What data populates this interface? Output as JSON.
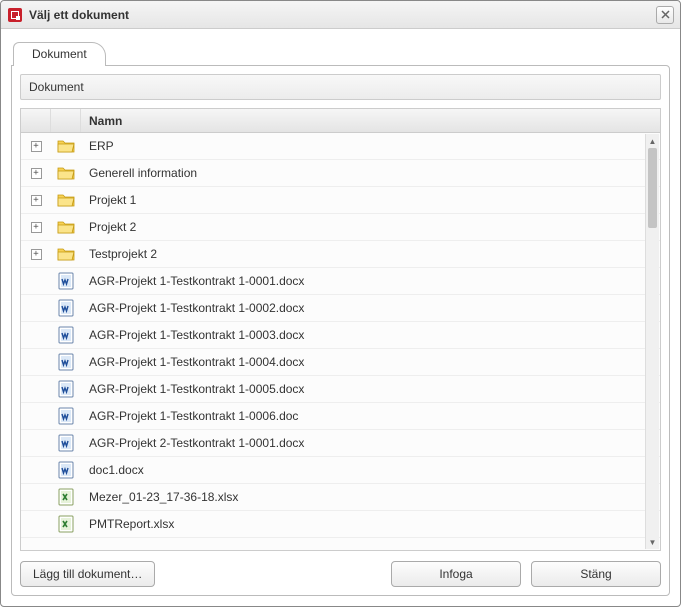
{
  "dialog": {
    "title": "Välj ett dokument"
  },
  "tabs": [
    {
      "label": "Dokument"
    }
  ],
  "panel": {
    "header": "Dokument"
  },
  "columns": {
    "name": "Namn"
  },
  "tree": [
    {
      "type": "folder",
      "expandable": true,
      "name": "ERP"
    },
    {
      "type": "folder",
      "expandable": true,
      "name": "Generell information"
    },
    {
      "type": "folder",
      "expandable": true,
      "name": "Projekt 1"
    },
    {
      "type": "folder",
      "expandable": true,
      "name": "Projekt 2"
    },
    {
      "type": "folder",
      "expandable": true,
      "name": "Testprojekt 2"
    },
    {
      "type": "docx",
      "expandable": false,
      "name": "AGR-Projekt 1-Testkontrakt 1-0001.docx"
    },
    {
      "type": "docx",
      "expandable": false,
      "name": "AGR-Projekt 1-Testkontrakt 1-0002.docx"
    },
    {
      "type": "docx",
      "expandable": false,
      "name": "AGR-Projekt 1-Testkontrakt 1-0003.docx"
    },
    {
      "type": "docx",
      "expandable": false,
      "name": "AGR-Projekt 1-Testkontrakt 1-0004.docx"
    },
    {
      "type": "docx",
      "expandable": false,
      "name": "AGR-Projekt 1-Testkontrakt 1-0005.docx"
    },
    {
      "type": "doc",
      "expandable": false,
      "name": "AGR-Projekt 1-Testkontrakt 1-0006.doc"
    },
    {
      "type": "docx",
      "expandable": false,
      "name": "AGR-Projekt 2-Testkontrakt 1-0001.docx"
    },
    {
      "type": "docx",
      "expandable": false,
      "name": "doc1.docx"
    },
    {
      "type": "xlsx",
      "expandable": false,
      "name": "Mezer_01-23_17-36-18.xlsx"
    },
    {
      "type": "xlsx",
      "expandable": false,
      "name": "PMTReport.xlsx"
    }
  ],
  "buttons": {
    "add": "Lägg till dokument…",
    "insert": "Infoga",
    "close": "Stäng"
  }
}
